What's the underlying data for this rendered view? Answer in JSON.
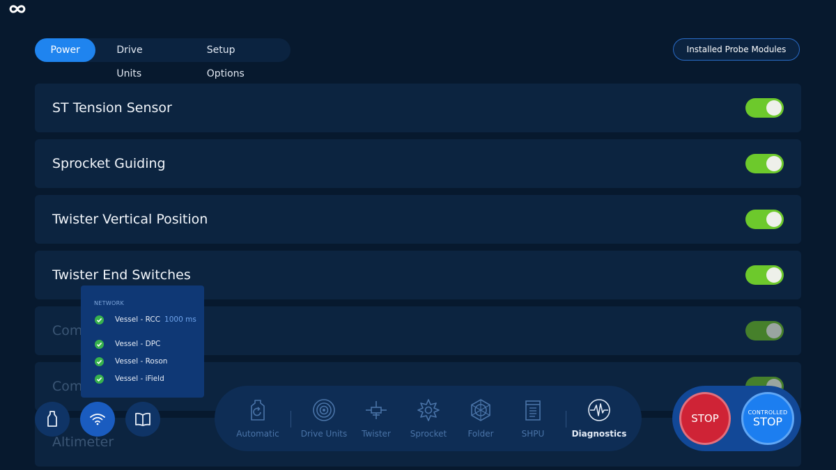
{
  "tabs": [
    {
      "label": "Power",
      "active": true
    },
    {
      "label": "Drive Units",
      "active": false
    },
    {
      "label": "Setup Options",
      "active": false
    }
  ],
  "installed_probe_modules_label": "Installed Probe Modules",
  "settings": [
    {
      "label": "ST Tension Sensor",
      "enabled": true
    },
    {
      "label": "Sprocket Guiding",
      "enabled": true
    },
    {
      "label": "Twister Vertical Position",
      "enabled": true
    },
    {
      "label": "Twister End Switches",
      "enabled": true
    },
    {
      "label": "Compensator SHPU",
      "enabled": true
    },
    {
      "label": "Compensator ROSON",
      "enabled": true
    },
    {
      "label": "Altimeter"
    }
  ],
  "network_popup": {
    "title": "NETWORK",
    "items": [
      {
        "label": "Vessel - RCC",
        "latency": "1000 ms",
        "status": "ok"
      },
      {
        "label": "Vessel - DPC",
        "status": "ok"
      },
      {
        "label": "Vessel - Roson",
        "status": "ok"
      },
      {
        "label": "Vessel - iField",
        "status": "ok"
      }
    ]
  },
  "quick_buttons": [
    {
      "icon": "bottle-icon"
    },
    {
      "icon": "wifi-icon",
      "active": true
    },
    {
      "icon": "book-icon"
    }
  ],
  "bottom_nav": [
    {
      "label": "Automatic",
      "icon": "automatic-icon"
    },
    {
      "label": "Drive Units",
      "icon": "drive-units-icon"
    },
    {
      "label": "Twister",
      "icon": "twister-icon"
    },
    {
      "label": "Sprocket",
      "icon": "sprocket-icon"
    },
    {
      "label": "Folder",
      "icon": "folder-icon"
    },
    {
      "label": "SHPU",
      "icon": "shpu-icon"
    },
    {
      "label": "Diagnostics",
      "icon": "diagnostics-icon",
      "active": true
    }
  ],
  "stop": {
    "stop_label": "STOP",
    "controlled_small": "CONTROLLED",
    "controlled_big": "STOP"
  },
  "colors": {
    "background": "#07192e",
    "accent": "#1f84ef",
    "toggle_on": "#6dc92c",
    "stop_red": "#cf2336",
    "controlled_blue": "#1c7ef0"
  }
}
